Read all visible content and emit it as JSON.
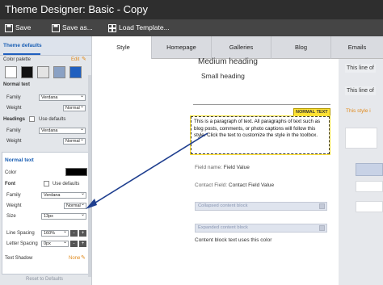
{
  "window": {
    "title": "Theme Designer:  Basic - Copy"
  },
  "toolbar": {
    "save": "Save",
    "save_as": "Save as...",
    "load_template": "Load Template..."
  },
  "sidebar": {
    "theme_defaults": "Theme defaults",
    "color_palette": "Color palette",
    "edit": "Edit",
    "palette_colors": [
      "#ffffff",
      "#111111",
      "#e4e4e4",
      "#8aa1c4",
      "#1f5fbf"
    ],
    "normal_text_heading": "Normal text",
    "family_label": "Family",
    "family_value": "Verdana",
    "weight_label": "Weight",
    "weight_value": "Normal",
    "headings_heading": "Headings",
    "use_defaults": "Use defaults",
    "headings_family_label": "Family",
    "headings_family_value": "Verdana",
    "headings_weight_label": "Weight",
    "headings_weight_value": "Normal",
    "panel": {
      "title": "Normal text",
      "color_label": "Color",
      "color_value": "#000000",
      "font_label": "Font",
      "use_defaults": "Use defaults",
      "family_label": "Family",
      "family_value": "Verdana",
      "weight_label": "Weight",
      "weight_value": "Normal",
      "size_label": "Size",
      "size_value": "13px",
      "line_spacing_label": "Line Spacing",
      "line_spacing_value": "160%",
      "letter_spacing_label": "Letter Spacing",
      "letter_spacing_value": "0px",
      "text_shadow_label": "Text Shadow",
      "text_shadow_value": "None"
    },
    "reset_label": "Reset to Defaults"
  },
  "tabs": [
    "Style",
    "Homepage",
    "Galleries",
    "Blog",
    "Emails"
  ],
  "preview": {
    "medium_heading": "Medium heading",
    "small_heading": "Small heading",
    "badge": "NORMAL TEXT",
    "paragraph": "This is a paragraph of text. All paragraphs of text such as blog posts, comments, or photo captions will follow this style. Click the text to customize the style in the toolbox.",
    "field_name_label": "Field name:",
    "field_value": "Field Value",
    "contact_field_label": "Contact Field:",
    "contact_field_value": "Contact Field Value",
    "collapsed_block": "Collapsed content block",
    "expanded_block": "Expanded content block",
    "content_block_text": "Content block text uses this color",
    "right_line_1": "This line of",
    "right_line_2": "This line of",
    "right_style": "This style i"
  },
  "colors": {
    "accent": "#1f5fbf",
    "badge_bg": "#ffe234",
    "right_style": "#e08a1c"
  }
}
